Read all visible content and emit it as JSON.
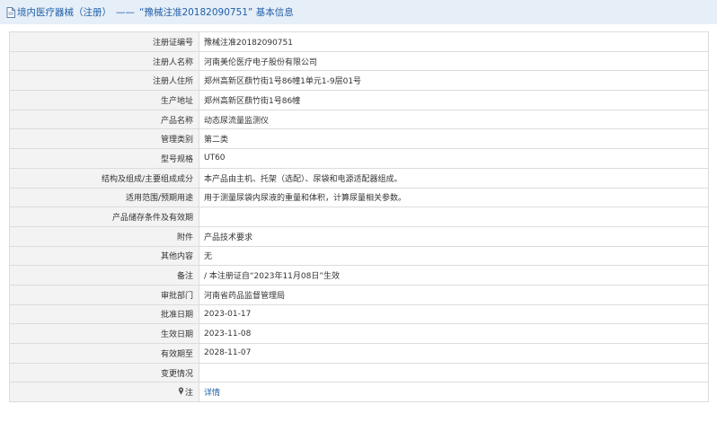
{
  "header": {
    "breadcrumb": "境内医疗器械（注册）",
    "separator": "——",
    "title": "“豫械注准20182090751” 基本信息"
  },
  "rows": [
    {
      "label": "注册证编号",
      "value": "豫械注准20182090751"
    },
    {
      "label": "注册人名称",
      "value": "河南美伦医疗电子股份有限公司"
    },
    {
      "label": "注册人住所",
      "value": "郑州高新区蕻竹街1号86幢1单元1-9层01号"
    },
    {
      "label": "生产地址",
      "value": "郑州高新区蕻竹街1号86幢"
    },
    {
      "label": "产品名称",
      "value": "动态尿流量监测仪"
    },
    {
      "label": "管理类别",
      "value": "第二类"
    },
    {
      "label": "型号规格",
      "value": "UT60"
    },
    {
      "label": "结构及组成/主要组成成分",
      "value": "本产品由主机、托架（选配）、尿袋和电源适配器组成。"
    },
    {
      "label": "适用范围/预期用途",
      "value": "用于测量尿袋内尿液的重量和体积，计算尿量相关参数。"
    },
    {
      "label": "产品储存条件及有效期",
      "value": ""
    },
    {
      "label": "附件",
      "value": "产品技术要求"
    },
    {
      "label": "其他内容",
      "value": "无"
    },
    {
      "label": "备注",
      "value": "/ 本注册证自“2023年11月08日”生效"
    },
    {
      "label": "审批部门",
      "value": "河南省药品监督管理局"
    },
    {
      "label": "批准日期",
      "value": "2023-01-17"
    },
    {
      "label": "生效日期",
      "value": "2023-11-08"
    },
    {
      "label": "有效期至",
      "value": "2028-11-07"
    },
    {
      "label": "变更情况",
      "value": ""
    }
  ],
  "note_row": {
    "label": "注",
    "link_text": "详情",
    "icon": "pin-icon"
  },
  "colors": {
    "link": "#1f5fa8",
    "header_bg": "#e6eef7",
    "label_bg": "#f3f3f3",
    "border": "#dcdcdc"
  }
}
